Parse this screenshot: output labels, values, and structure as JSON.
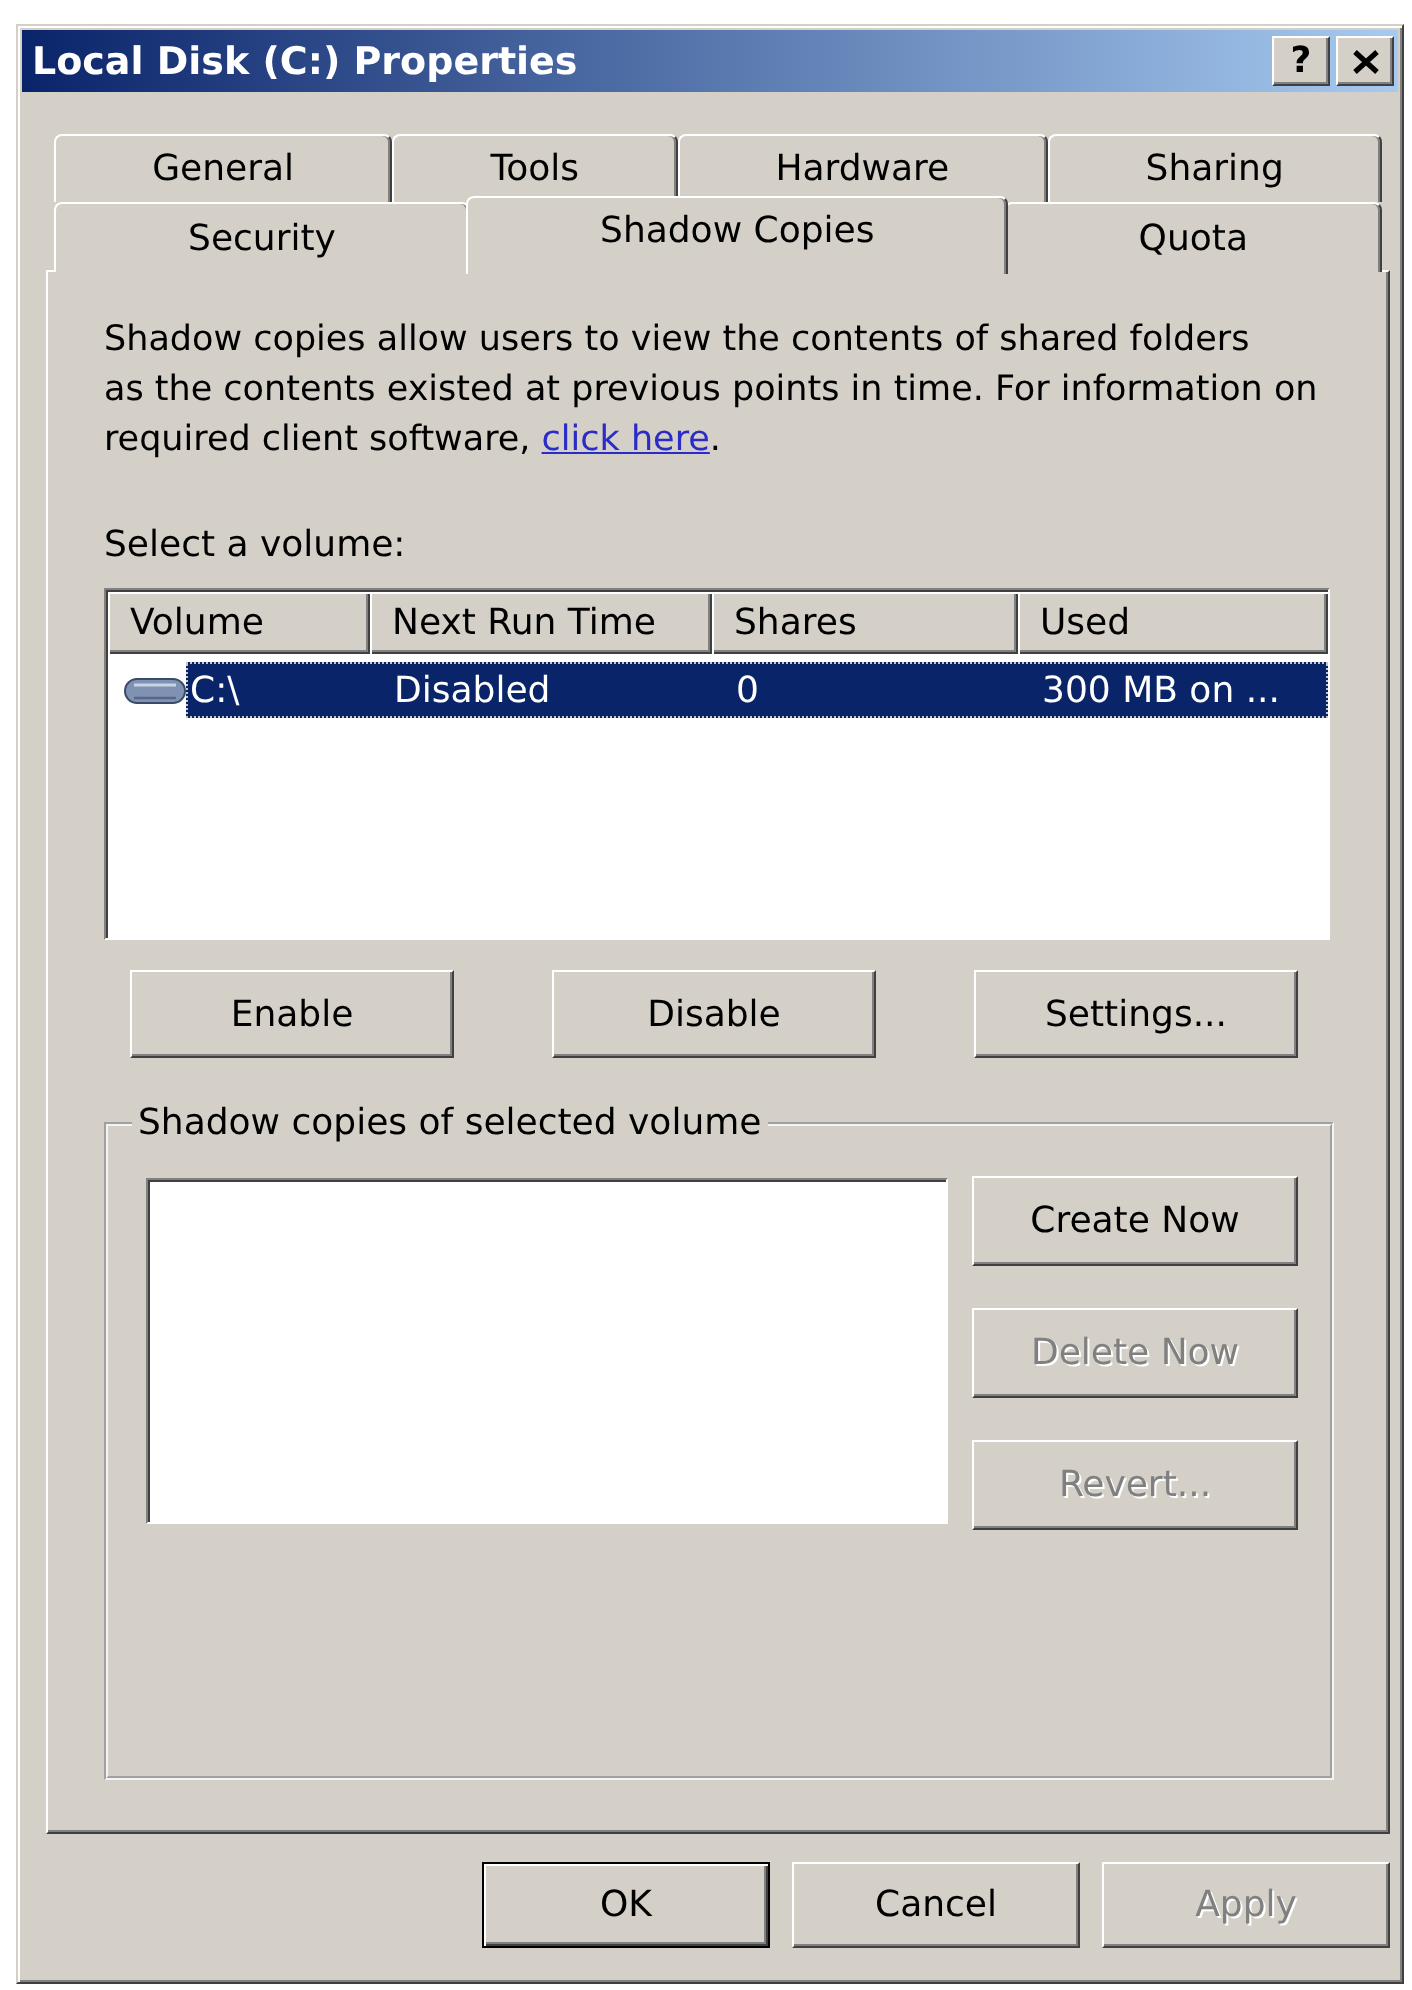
{
  "window": {
    "title": "Local Disk (C:) Properties",
    "help_button": "?"
  },
  "tab_rows": [
    [
      {
        "label": "General",
        "selected": false
      },
      {
        "label": "Tools",
        "selected": false
      },
      {
        "label": "Hardware",
        "selected": false
      },
      {
        "label": "Sharing",
        "selected": false
      }
    ],
    [
      {
        "label": "Security",
        "selected": false
      },
      {
        "label": "Shadow Copies",
        "selected": true
      },
      {
        "label": "Quota",
        "selected": false
      }
    ]
  ],
  "description": {
    "text": "Shadow copies allow users to view the contents of shared folders\nas the contents existed at previous points in time. For information on\nrequired client software,",
    "link": "click here",
    "text_after": "."
  },
  "volume_list": {
    "label": "Select a volume:",
    "columns": [
      "Volume",
      "Next Run Time",
      "Shares",
      "Used"
    ],
    "rows": [
      {
        "cells": [
          "C:\\",
          "Disabled",
          "0",
          "300 MB on ..."
        ],
        "selected": true
      }
    ]
  },
  "volume_buttons": [
    {
      "label": "Enable",
      "disabled": false
    },
    {
      "label": "Disable",
      "disabled": false
    },
    {
      "label": "Settings...",
      "disabled": false
    }
  ],
  "shadow_copies": {
    "label": "Shadow copies of selected volume",
    "buttons": [
      {
        "label": "Create Now",
        "disabled": false
      },
      {
        "label": "Delete Now",
        "disabled": true
      },
      {
        "label": "Revert...",
        "disabled": true
      }
    ]
  },
  "dialog_buttons": [
    {
      "label": "OK",
      "default": true,
      "disabled": false
    },
    {
      "label": "Cancel",
      "default": false,
      "disabled": false
    },
    {
      "label": "Apply",
      "default": false,
      "disabled": true
    }
  ]
}
